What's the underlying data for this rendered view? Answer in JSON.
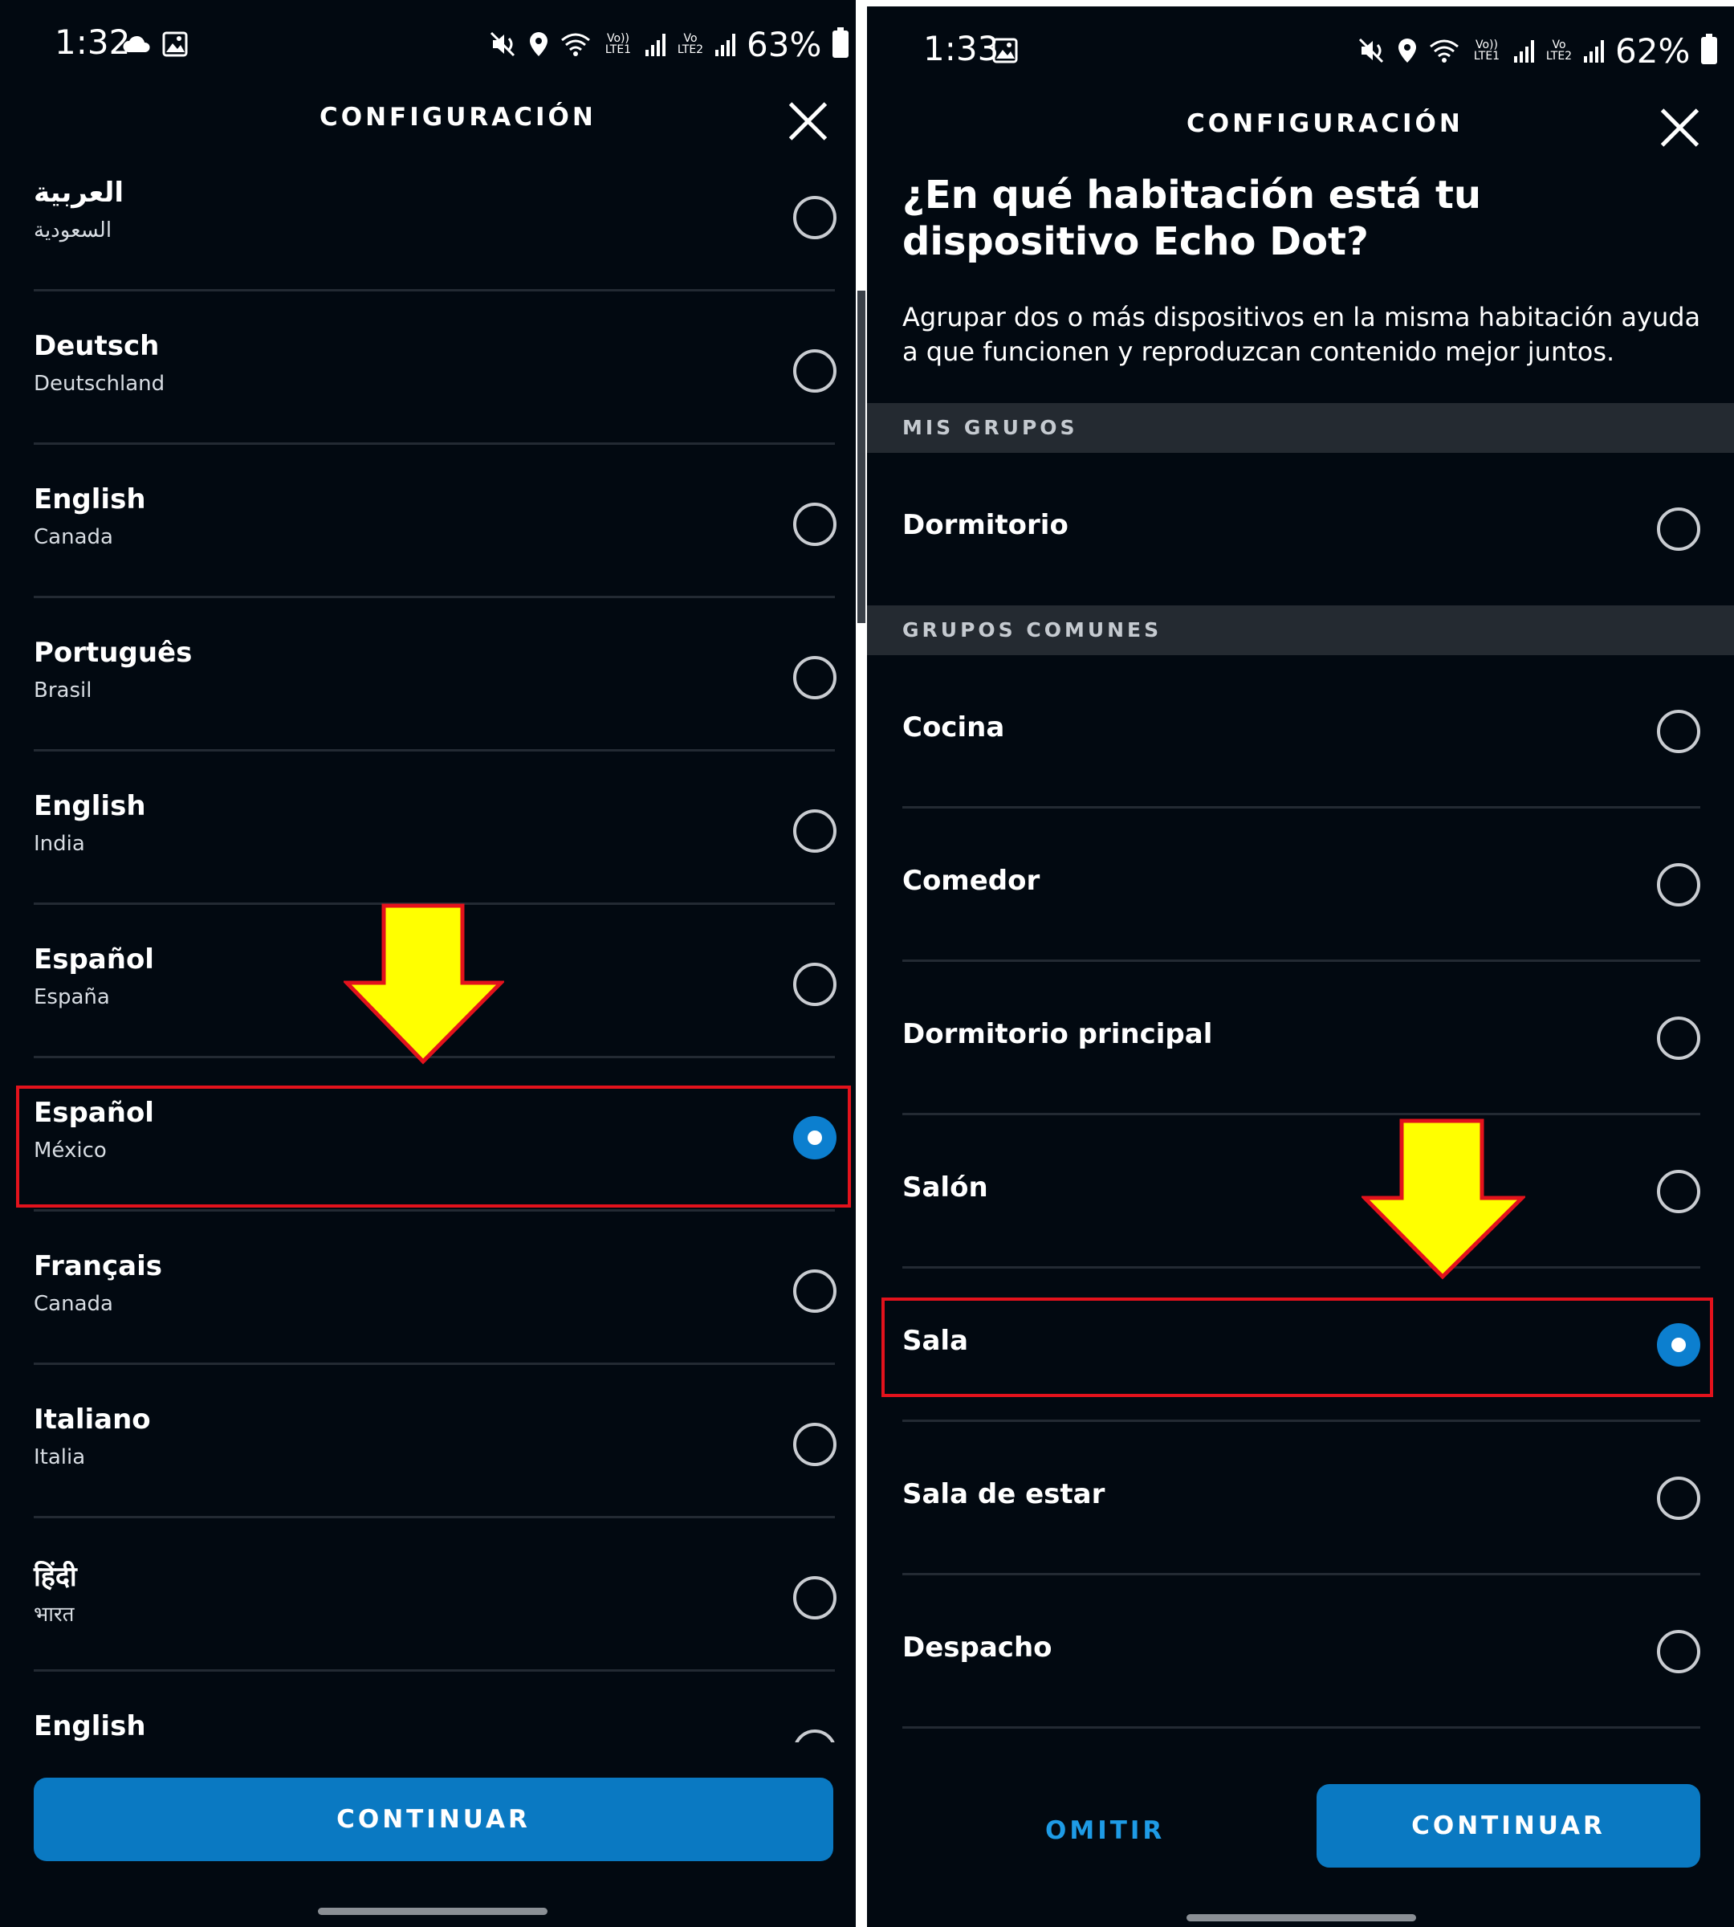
{
  "left": {
    "status": {
      "time": "1:32",
      "battery": "63%",
      "network1": "Vo)) LTE1",
      "network2": "Vo LTE2"
    },
    "header_title": "CONFIGURACIÓN",
    "languages": [
      {
        "name": "العربية",
        "region": "السعودية",
        "selected": false
      },
      {
        "name": "Deutsch",
        "region": "Deutschland",
        "selected": false
      },
      {
        "name": "English",
        "region": "Canada",
        "selected": false
      },
      {
        "name": "Português",
        "region": "Brasil",
        "selected": false
      },
      {
        "name": "English",
        "region": "India",
        "selected": false
      },
      {
        "name": "Español",
        "region": "España",
        "selected": false
      },
      {
        "name": "Español",
        "region": "México",
        "selected": true
      },
      {
        "name": "Français",
        "region": "Canada",
        "selected": false
      },
      {
        "name": "Italiano",
        "region": "Italia",
        "selected": false
      },
      {
        "name": "हिंदी",
        "region": "भारत",
        "selected": false
      },
      {
        "name": "English",
        "region": "",
        "selected": false
      }
    ],
    "continue_label": "CONTINUAR"
  },
  "right": {
    "status": {
      "time": "1:33",
      "battery": "62%",
      "network1": "Vo)) LTE1",
      "network2": "Vo LTE2"
    },
    "header_title": "CONFIGURACIÓN",
    "question": "¿En qué habitación está tu dispositivo Echo Dot?",
    "subtitle": "Agrupar dos o más dispositivos en la misma habitación ayuda a que funcionen y reproduzcan contenido mejor juntos.",
    "my_groups_header": "MIS GRUPOS",
    "my_groups": [
      {
        "name": "Dormitorio",
        "selected": false
      }
    ],
    "common_groups_header": "GRUPOS COMUNES",
    "common_groups": [
      {
        "name": "Cocina",
        "selected": false
      },
      {
        "name": "Comedor",
        "selected": false
      },
      {
        "name": "Dormitorio principal",
        "selected": false
      },
      {
        "name": "Salón",
        "selected": false
      },
      {
        "name": "Sala",
        "selected": true
      },
      {
        "name": "Sala de estar",
        "selected": false
      },
      {
        "name": "Despacho",
        "selected": false
      }
    ],
    "skip_label": "OMITIR",
    "continue_label": "CONTINUAR"
  },
  "colors": {
    "background": "#020911",
    "accent": "#0a79c2",
    "highlight": "#e3121c",
    "arrow": "#ffff00"
  },
  "icons": [
    "cloud-icon",
    "image-icon",
    "mute-icon",
    "location-icon",
    "wifi-icon",
    "signal-icon",
    "battery-icon",
    "close-icon",
    "radio-button",
    "arrow-down-icon"
  ]
}
